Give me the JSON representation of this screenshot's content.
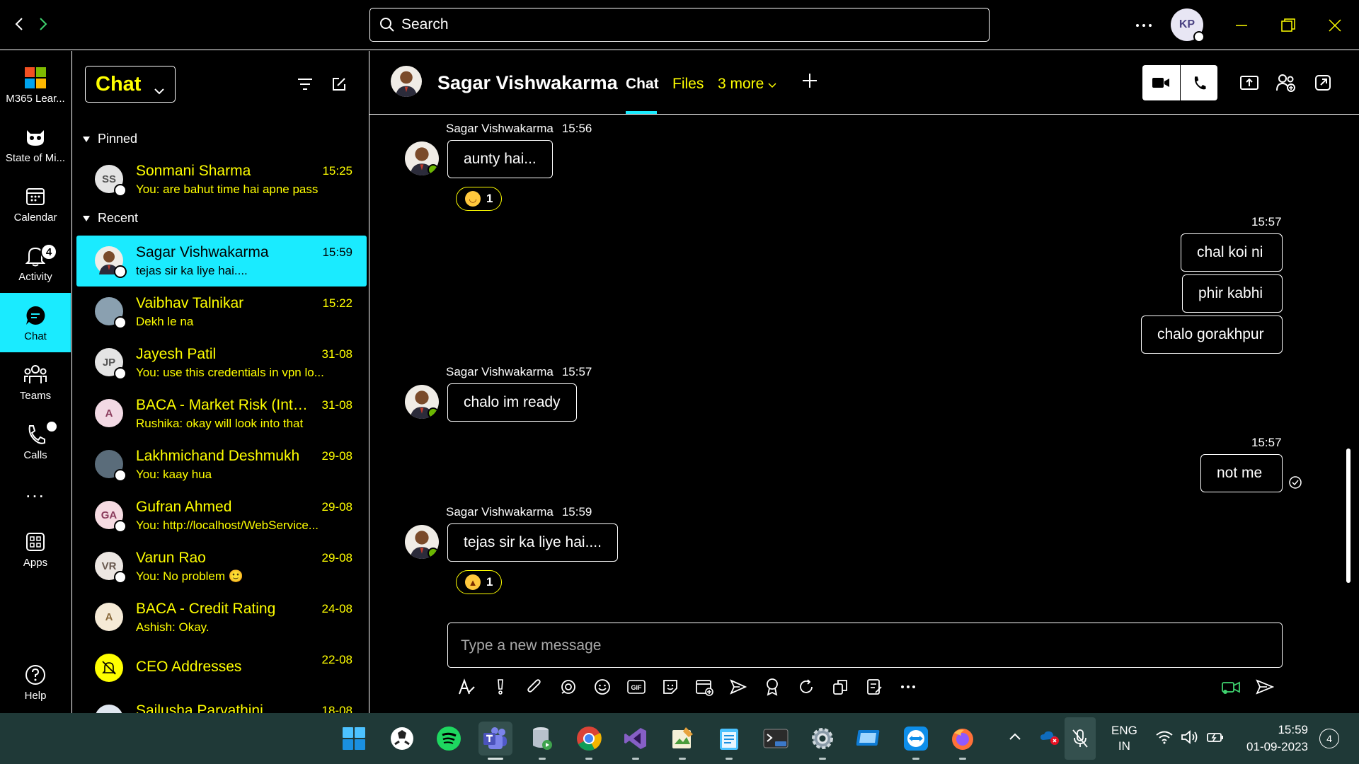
{
  "titlebar": {
    "search_placeholder": "Search",
    "account_initials": "KP",
    "colors": {
      "background": "#000000",
      "border": "#ffffff"
    }
  },
  "rail": {
    "items": [
      {
        "label": "M365 Lear...",
        "icon": "m365-icon"
      },
      {
        "label": "State of Mi...",
        "icon": "owl-icon"
      },
      {
        "label": "Calendar",
        "icon": "calendar-icon"
      },
      {
        "label": "Activity",
        "icon": "bell-icon",
        "badge": "4"
      },
      {
        "label": "Chat",
        "icon": "chat-icon",
        "active": true
      },
      {
        "label": "Teams",
        "icon": "teams-icon"
      },
      {
        "label": "Calls",
        "icon": "phone-icon"
      },
      {
        "label": "...",
        "icon": "more-icon"
      },
      {
        "label": "Apps",
        "icon": "apps-icon"
      },
      {
        "label": "Help",
        "icon": "help-icon"
      }
    ],
    "active_color": "#1aebff"
  },
  "chatlist": {
    "title": "Chat",
    "sections": {
      "pinned": "Pinned",
      "recent": "Recent"
    },
    "pinned": [
      {
        "initials": "SS",
        "name": "Sonmani Sharma",
        "preview": "You: are bahut time hai apne pass",
        "time": "15:25"
      }
    ],
    "recent": [
      {
        "initials": "",
        "name": "Sagar Vishwakarma",
        "preview": "tejas sir ka liye hai....",
        "time": "15:59",
        "selected": true
      },
      {
        "initials": "",
        "name": "Vaibhav Talnikar",
        "preview": "Dekh le na",
        "time": "15:22"
      },
      {
        "initials": "JP",
        "name": "Jayesh Patil",
        "preview": "You: use this credentials in vpn lo...",
        "time": "31-08"
      },
      {
        "initials": "A",
        "name": "BACA - Market Risk (Inte...",
        "preview": "Rushika: okay will look into that",
        "time": "31-08"
      },
      {
        "initials": "",
        "name": "Lakhmichand Deshmukh",
        "preview": "You: kaay hua",
        "time": "29-08"
      },
      {
        "initials": "GA",
        "name": "Gufran Ahmed",
        "preview": "You: http://localhost/WebService...",
        "time": "29-08"
      },
      {
        "initials": "VR",
        "name": "Varun Rao",
        "preview": "You: No problem 🙂",
        "time": "29-08"
      },
      {
        "initials": "A",
        "name": "BACA - Credit Rating",
        "preview": "Ashish: Okay.",
        "time": "24-08"
      },
      {
        "initials": "",
        "name": "CEO Addresses",
        "preview": "",
        "time": "22-08"
      },
      {
        "initials": "",
        "name": "Sailusha Parvathini",
        "preview": "",
        "time": "18-08"
      }
    ],
    "text_color": "#ffff00",
    "selected_color": "#1aebff"
  },
  "conversation": {
    "name": "Sagar Vishwakarma",
    "tabs": {
      "chat": "Chat",
      "files": "Files",
      "more": "3 more"
    },
    "composer_placeholder": "Type a new message",
    "messages": [
      {
        "from": "Sagar Vishwakarma",
        "time": "15:56",
        "text": "aunty hai...",
        "reaction": {
          "emoji": "laughing-emoji",
          "count": "1"
        }
      },
      {
        "from": "me",
        "time": "15:57",
        "lines": [
          "chal koi ni",
          "phir kabhi",
          "chalo gorakhpur"
        ]
      },
      {
        "from": "Sagar Vishwakarma",
        "time": "15:57",
        "text": "chalo im ready"
      },
      {
        "from": "me",
        "time": "15:57",
        "lines": [
          "not me"
        ],
        "status": "seen"
      },
      {
        "from": "Sagar Vishwakarma",
        "time": "15:59",
        "text": "tejas sir ka liye hai....",
        "reaction": {
          "emoji": "thumbs-up-emoji",
          "count": "1"
        }
      }
    ]
  },
  "taskbar": {
    "language": "ENG",
    "region": "IN",
    "time": "15:59",
    "date": "01-09-2023",
    "notifications": "4",
    "background": "#1f3937"
  }
}
